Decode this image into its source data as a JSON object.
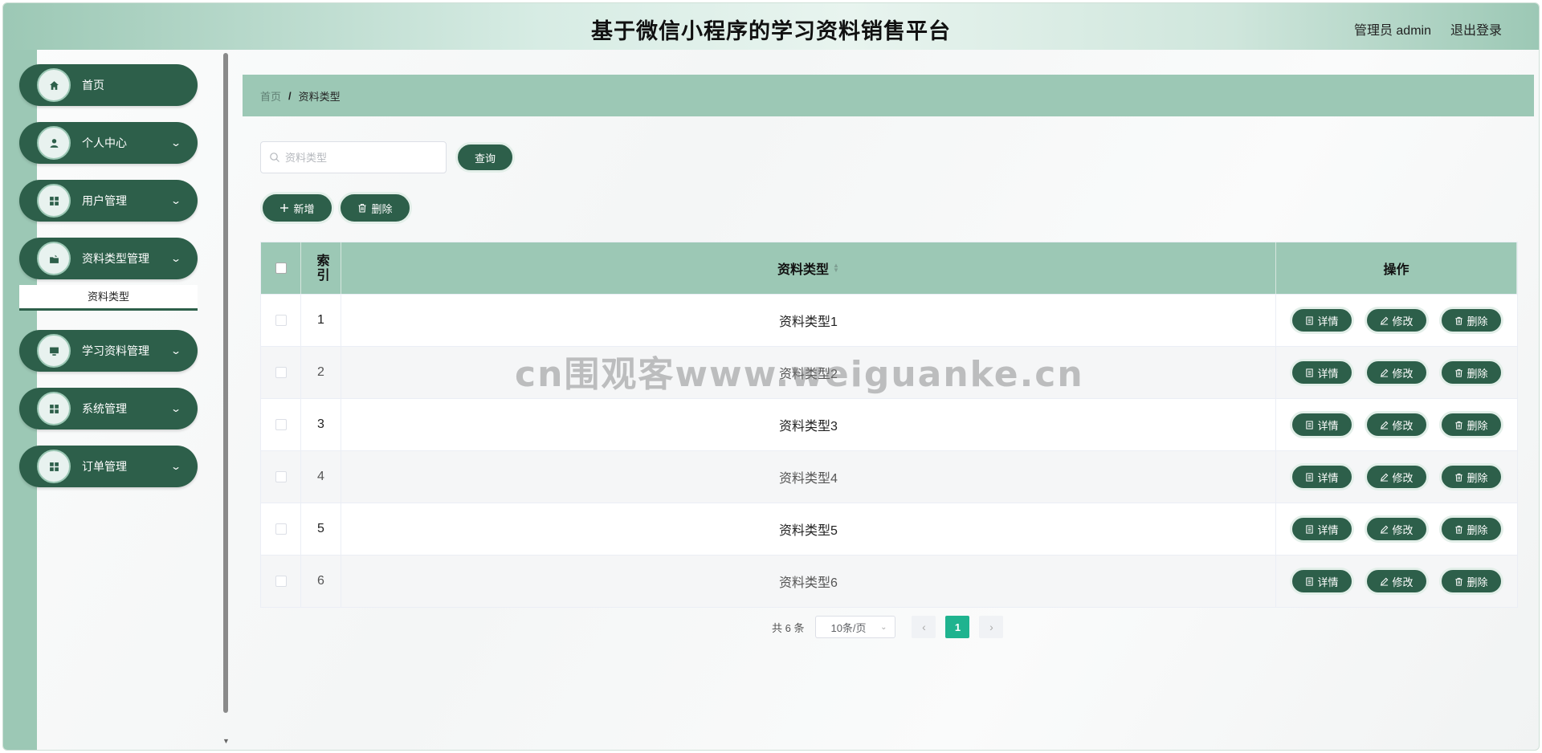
{
  "header": {
    "title": "基于微信小程序的学习资料销售平台",
    "user": "管理员 admin",
    "logout": "退出登录"
  },
  "sidebar": {
    "items": [
      {
        "label": "首页",
        "icon": "home-icon",
        "chevron": false
      },
      {
        "label": "个人中心",
        "icon": "user-icon",
        "chevron": true
      },
      {
        "label": "用户管理",
        "icon": "grid-icon",
        "chevron": true
      },
      {
        "label": "资料类型管理",
        "icon": "folder-icon",
        "chevron": true
      },
      {
        "label": "学习资料管理",
        "icon": "monitor-icon",
        "chevron": true
      },
      {
        "label": "系统管理",
        "icon": "grid-icon",
        "chevron": true
      },
      {
        "label": "订单管理",
        "icon": "grid-icon",
        "chevron": true
      }
    ],
    "submenu": "资料类型"
  },
  "breadcrumb": {
    "home": "首页",
    "separator": "/",
    "current": "资料类型"
  },
  "search": {
    "placeholder": "资料类型",
    "button": "查询"
  },
  "actions": {
    "add": "新增",
    "delete": "删除"
  },
  "table": {
    "headers": {
      "index": "索引",
      "type": "资料类型",
      "ops": "操作"
    },
    "rows": [
      {
        "index": "1",
        "type": "资料类型1"
      },
      {
        "index": "2",
        "type": "资料类型2"
      },
      {
        "index": "3",
        "type": "资料类型3"
      },
      {
        "index": "4",
        "type": "资料类型4"
      },
      {
        "index": "5",
        "type": "资料类型5"
      },
      {
        "index": "6",
        "type": "资料类型6"
      }
    ],
    "op_labels": {
      "detail": "详情",
      "edit": "修改",
      "delete": "删除"
    }
  },
  "pagination": {
    "total": "共 6 条",
    "page_size": "10条/页",
    "current": "1"
  },
  "watermark": "cn围观客www.weiguanke.cn",
  "colors": {
    "primary": "#2d5f4a",
    "accent": "#9cc8b5",
    "page_active": "#1fb38f"
  }
}
